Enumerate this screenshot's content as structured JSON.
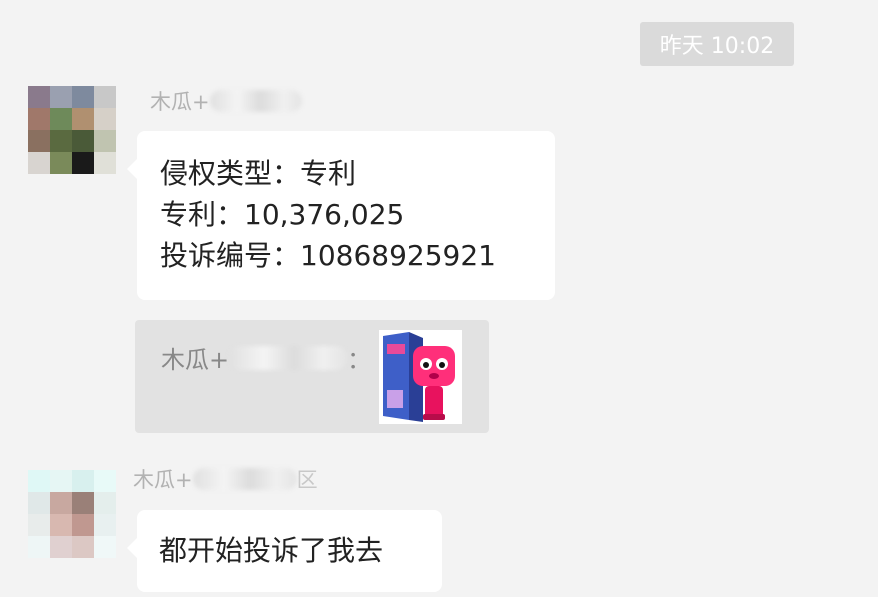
{
  "timestamp": "昨天 10:02",
  "messages": [
    {
      "sender_prefix": "木瓜+",
      "lines": [
        "侵权类型：专利",
        "专利：10,376,025",
        "投诉编号：10868925921"
      ]
    },
    {
      "quote": {
        "sender_prefix": "木瓜+",
        "colon": "：",
        "thumbnail": "product-photo-pink-toy-fan"
      }
    },
    {
      "sender_prefix": "木瓜+",
      "sender_suffix_partial": "区",
      "text": "都开始投诉了我去"
    }
  ]
}
